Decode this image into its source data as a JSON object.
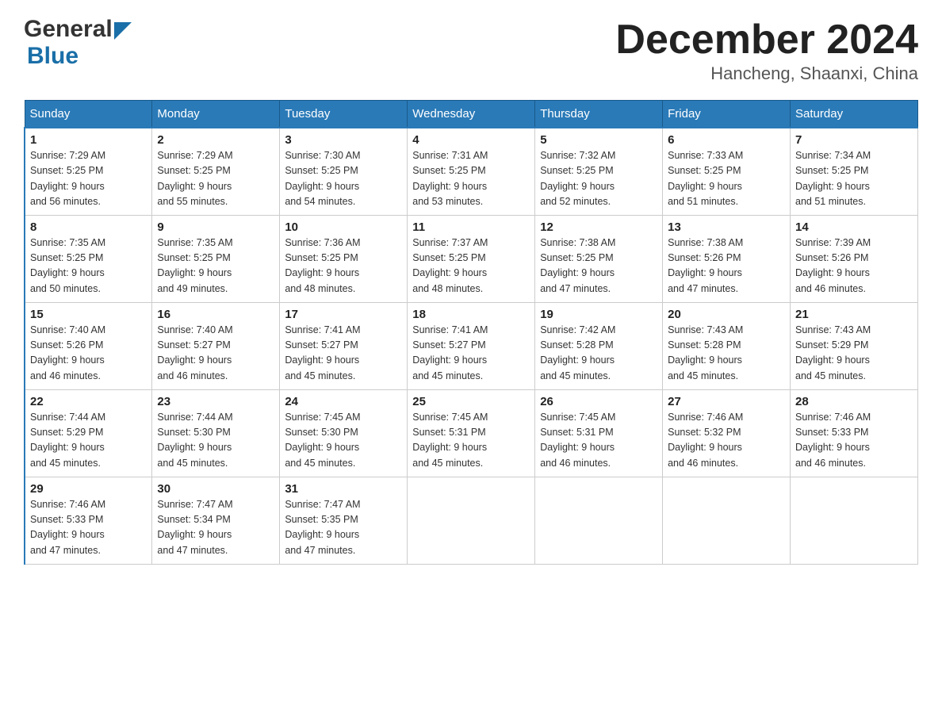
{
  "logo": {
    "general": "General",
    "blue": "Blue",
    "tagline": "Blue"
  },
  "header": {
    "month": "December 2024",
    "location": "Hancheng, Shaanxi, China"
  },
  "days_of_week": [
    "Sunday",
    "Monday",
    "Tuesday",
    "Wednesday",
    "Thursday",
    "Friday",
    "Saturday"
  ],
  "weeks": [
    [
      {
        "day": "1",
        "sunrise": "7:29 AM",
        "sunset": "5:25 PM",
        "daylight": "9 hours and 56 minutes."
      },
      {
        "day": "2",
        "sunrise": "7:29 AM",
        "sunset": "5:25 PM",
        "daylight": "9 hours and 55 minutes."
      },
      {
        "day": "3",
        "sunrise": "7:30 AM",
        "sunset": "5:25 PM",
        "daylight": "9 hours and 54 minutes."
      },
      {
        "day": "4",
        "sunrise": "7:31 AM",
        "sunset": "5:25 PM",
        "daylight": "9 hours and 53 minutes."
      },
      {
        "day": "5",
        "sunrise": "7:32 AM",
        "sunset": "5:25 PM",
        "daylight": "9 hours and 52 minutes."
      },
      {
        "day": "6",
        "sunrise": "7:33 AM",
        "sunset": "5:25 PM",
        "daylight": "9 hours and 51 minutes."
      },
      {
        "day": "7",
        "sunrise": "7:34 AM",
        "sunset": "5:25 PM",
        "daylight": "9 hours and 51 minutes."
      }
    ],
    [
      {
        "day": "8",
        "sunrise": "7:35 AM",
        "sunset": "5:25 PM",
        "daylight": "9 hours and 50 minutes."
      },
      {
        "day": "9",
        "sunrise": "7:35 AM",
        "sunset": "5:25 PM",
        "daylight": "9 hours and 49 minutes."
      },
      {
        "day": "10",
        "sunrise": "7:36 AM",
        "sunset": "5:25 PM",
        "daylight": "9 hours and 48 minutes."
      },
      {
        "day": "11",
        "sunrise": "7:37 AM",
        "sunset": "5:25 PM",
        "daylight": "9 hours and 48 minutes."
      },
      {
        "day": "12",
        "sunrise": "7:38 AM",
        "sunset": "5:25 PM",
        "daylight": "9 hours and 47 minutes."
      },
      {
        "day": "13",
        "sunrise": "7:38 AM",
        "sunset": "5:26 PM",
        "daylight": "9 hours and 47 minutes."
      },
      {
        "day": "14",
        "sunrise": "7:39 AM",
        "sunset": "5:26 PM",
        "daylight": "9 hours and 46 minutes."
      }
    ],
    [
      {
        "day": "15",
        "sunrise": "7:40 AM",
        "sunset": "5:26 PM",
        "daylight": "9 hours and 46 minutes."
      },
      {
        "day": "16",
        "sunrise": "7:40 AM",
        "sunset": "5:27 PM",
        "daylight": "9 hours and 46 minutes."
      },
      {
        "day": "17",
        "sunrise": "7:41 AM",
        "sunset": "5:27 PM",
        "daylight": "9 hours and 45 minutes."
      },
      {
        "day": "18",
        "sunrise": "7:41 AM",
        "sunset": "5:27 PM",
        "daylight": "9 hours and 45 minutes."
      },
      {
        "day": "19",
        "sunrise": "7:42 AM",
        "sunset": "5:28 PM",
        "daylight": "9 hours and 45 minutes."
      },
      {
        "day": "20",
        "sunrise": "7:43 AM",
        "sunset": "5:28 PM",
        "daylight": "9 hours and 45 minutes."
      },
      {
        "day": "21",
        "sunrise": "7:43 AM",
        "sunset": "5:29 PM",
        "daylight": "9 hours and 45 minutes."
      }
    ],
    [
      {
        "day": "22",
        "sunrise": "7:44 AM",
        "sunset": "5:29 PM",
        "daylight": "9 hours and 45 minutes."
      },
      {
        "day": "23",
        "sunrise": "7:44 AM",
        "sunset": "5:30 PM",
        "daylight": "9 hours and 45 minutes."
      },
      {
        "day": "24",
        "sunrise": "7:45 AM",
        "sunset": "5:30 PM",
        "daylight": "9 hours and 45 minutes."
      },
      {
        "day": "25",
        "sunrise": "7:45 AM",
        "sunset": "5:31 PM",
        "daylight": "9 hours and 45 minutes."
      },
      {
        "day": "26",
        "sunrise": "7:45 AM",
        "sunset": "5:31 PM",
        "daylight": "9 hours and 46 minutes."
      },
      {
        "day": "27",
        "sunrise": "7:46 AM",
        "sunset": "5:32 PM",
        "daylight": "9 hours and 46 minutes."
      },
      {
        "day": "28",
        "sunrise": "7:46 AM",
        "sunset": "5:33 PM",
        "daylight": "9 hours and 46 minutes."
      }
    ],
    [
      {
        "day": "29",
        "sunrise": "7:46 AM",
        "sunset": "5:33 PM",
        "daylight": "9 hours and 47 minutes."
      },
      {
        "day": "30",
        "sunrise": "7:47 AM",
        "sunset": "5:34 PM",
        "daylight": "9 hours and 47 minutes."
      },
      {
        "day": "31",
        "sunrise": "7:47 AM",
        "sunset": "5:35 PM",
        "daylight": "9 hours and 47 minutes."
      },
      null,
      null,
      null,
      null
    ]
  ]
}
